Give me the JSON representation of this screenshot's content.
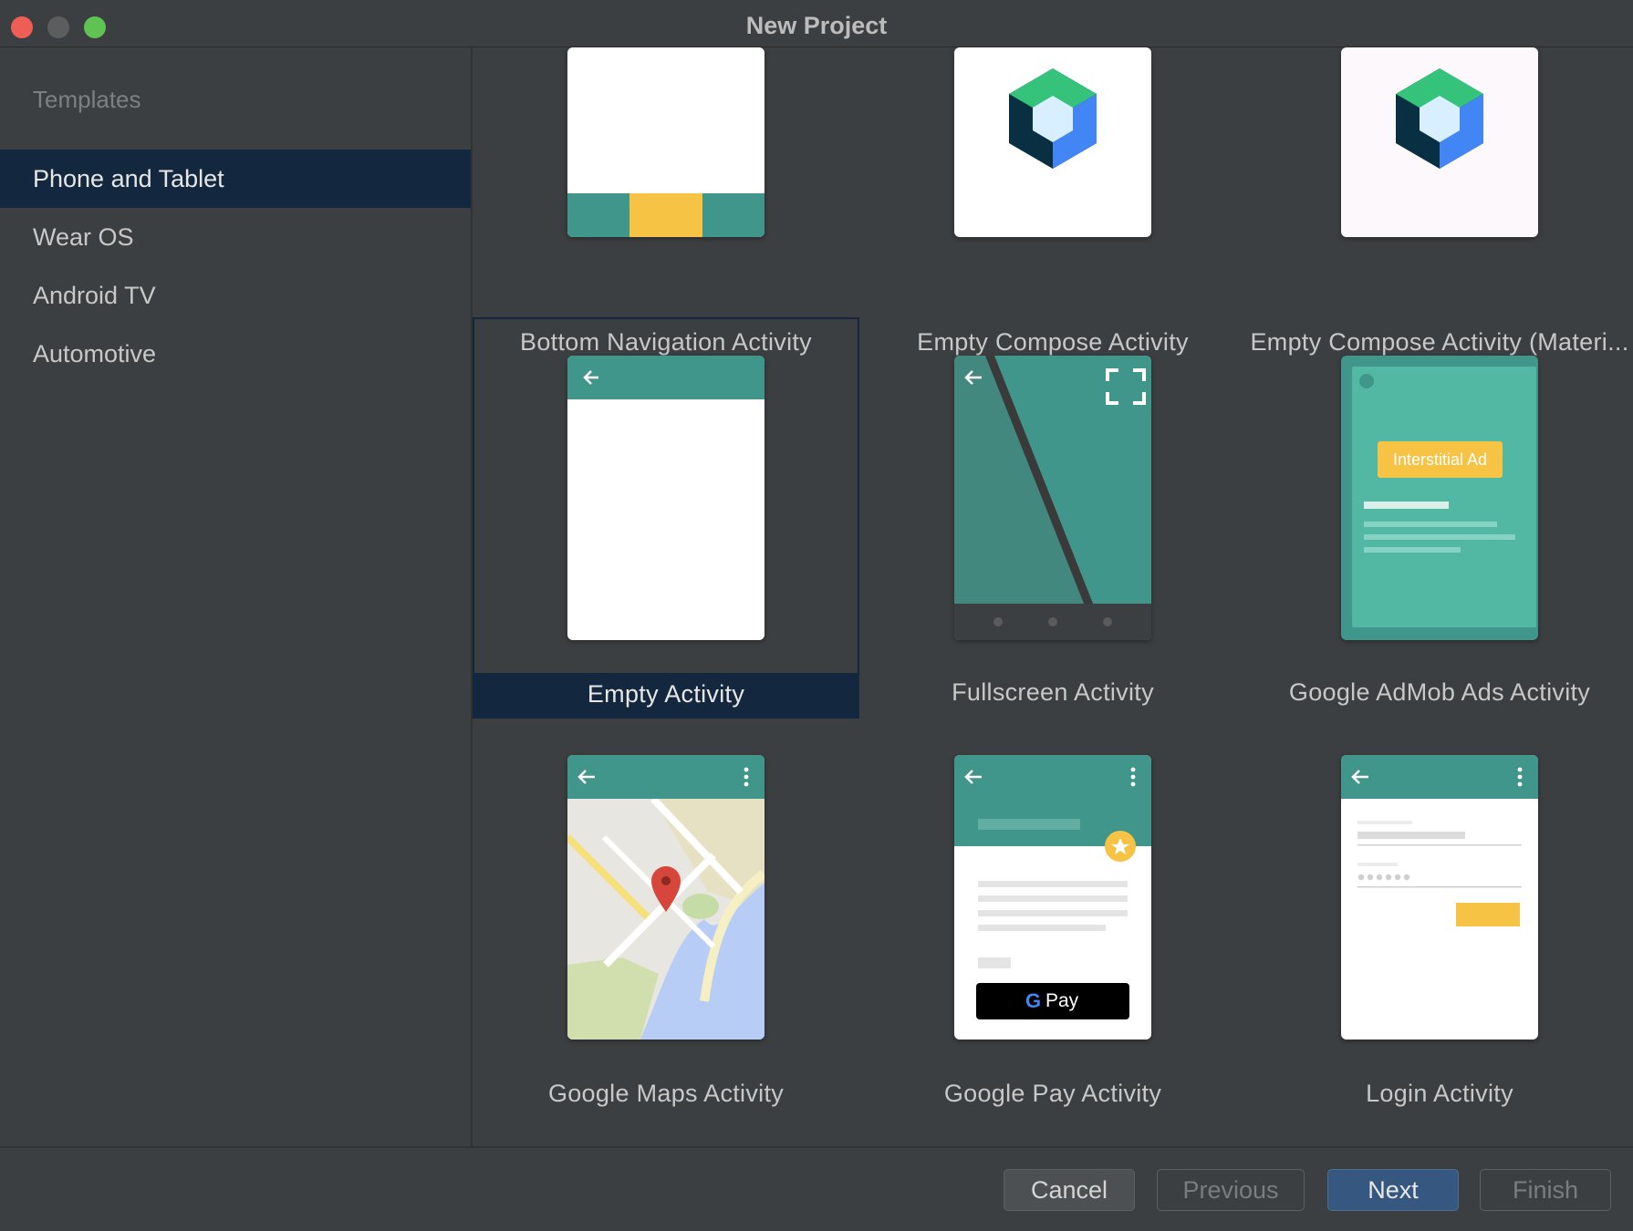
{
  "window": {
    "title": "New Project"
  },
  "sidebar": {
    "heading": "Templates",
    "items": [
      {
        "label": "Phone and Tablet",
        "selected": true
      },
      {
        "label": "Wear OS",
        "selected": false
      },
      {
        "label": "Android TV",
        "selected": false
      },
      {
        "label": "Automotive",
        "selected": false
      }
    ]
  },
  "templates": [
    {
      "label": "Bottom Navigation Activity"
    },
    {
      "label": "Empty Compose Activity"
    },
    {
      "label": "Empty Compose Activity (Materi..."
    },
    {
      "label": "Empty Activity",
      "selected": true
    },
    {
      "label": "Fullscreen Activity"
    },
    {
      "label": "Google AdMob Ads Activity",
      "badge": "Interstitial Ad"
    },
    {
      "label": "Google Maps Activity"
    },
    {
      "label": "Google Pay Activity",
      "pay_label": "Pay"
    },
    {
      "label": "Login Activity"
    }
  ],
  "buttons": {
    "cancel": "Cancel",
    "previous": "Previous",
    "next": "Next",
    "finish": "Finish"
  },
  "colors": {
    "accent_teal": "#40968a",
    "selection": "#13283e",
    "primary_button": "#365880",
    "yellow": "#f6c344"
  }
}
